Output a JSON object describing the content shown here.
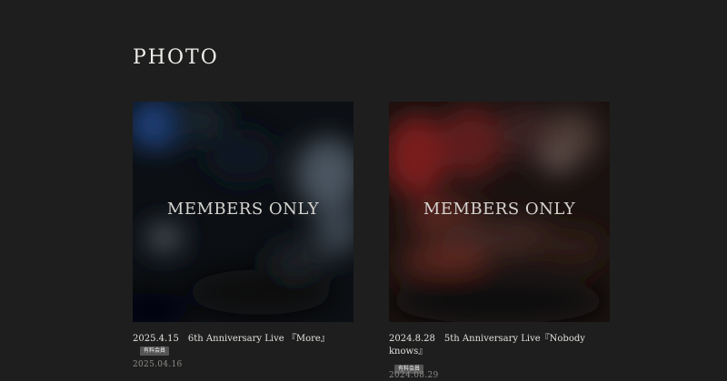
{
  "section": {
    "title": "PHOTO"
  },
  "cards": [
    {
      "lock_label": "MEMBERS ONLY",
      "date_code": "2025.4.15",
      "title": "6th Anniversary Live 『More』",
      "badge": "有料会員",
      "published": "2025.04.16"
    },
    {
      "lock_label": "MEMBERS ONLY",
      "date_code": "2024.8.28",
      "title": "5th Anniversary Live『Nobody knows』",
      "badge": "有料会員",
      "published": "2024.08.29"
    }
  ],
  "colors": {
    "background": "#1e1e1e",
    "badge": "#555555",
    "muted_text": "#8e8c88"
  }
}
